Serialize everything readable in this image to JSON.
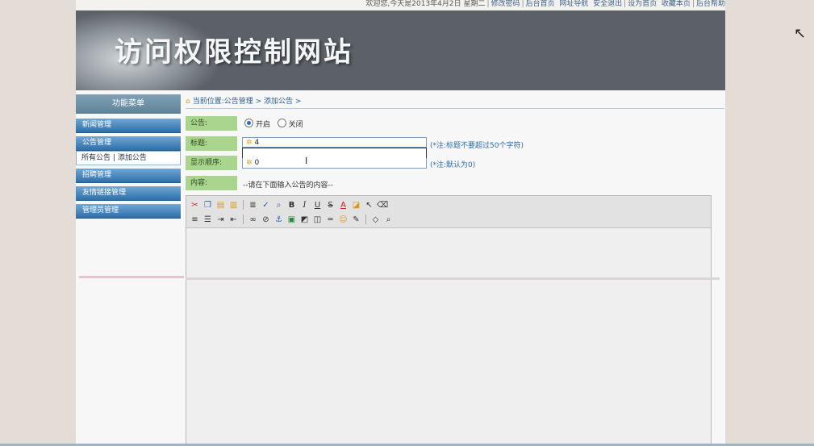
{
  "topbar": {
    "welcome": "欢迎您,今天是2013年4月2日 星期二",
    "links": [
      "修改密码",
      "后台首页",
      "网址导航",
      "安全退出",
      "设为首页",
      "收藏本页",
      "后台帮助"
    ]
  },
  "banner": {
    "title": "访问权限控制网站"
  },
  "sidebar": {
    "header": "功能菜单",
    "items": [
      {
        "label": "新闻管理"
      },
      {
        "label": "公告管理"
      },
      {
        "label": "招聘管理"
      },
      {
        "label": "友情链接管理"
      },
      {
        "label": "管理员管理"
      }
    ],
    "submenu": {
      "link1": "所有公告",
      "sep": "|",
      "link2": "添加公告"
    }
  },
  "breadcrumb": {
    "text": "当前位置:公告管理 > 添加公告 >"
  },
  "form": {
    "notice_label": "公告:",
    "radio_on": "开启",
    "radio_off": "关闭",
    "title_label": "标题:",
    "title_value": "4",
    "title_note": "(*注:标题不要超过50个字符)",
    "order_label": "显示顺序:",
    "order_value": "0",
    "order_note": "(*注:默认为0)",
    "content_label": "内容:",
    "content_hint": "--请在下面输入公告的内容--"
  },
  "editor": {
    "row1_icons": [
      "cut-icon",
      "copy-icon",
      "paste-icon",
      "paste-word-icon",
      "format-icon",
      "spellcheck-icon",
      "find-icon",
      "bold-icon",
      "italic-icon",
      "underline-icon",
      "strikethrough-icon",
      "font-color-icon",
      "bg-color-icon",
      "select-icon",
      "eraser-icon"
    ],
    "row2_icons": [
      "align-icon",
      "list-icon",
      "indent-icon",
      "outdent-icon",
      "link-icon",
      "unlink-icon",
      "anchor-icon",
      "image-icon",
      "flash-icon",
      "media-icon",
      "hr-icon",
      "emoticon-icon",
      "edit-icon",
      "source-icon",
      "preview-icon"
    ],
    "bold": "B",
    "italic": "I",
    "underline": "U",
    "strike": "S",
    "fontcolor": "A"
  }
}
